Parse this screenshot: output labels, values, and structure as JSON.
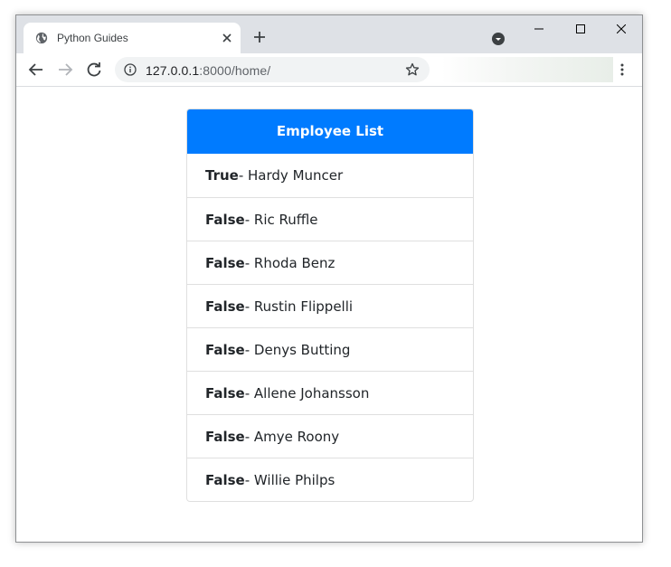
{
  "browser": {
    "tab_title": "Python Guides",
    "url_host": "127.0.0.1",
    "url_path": ":8000/home/"
  },
  "card": {
    "header": "Employee List",
    "items": [
      {
        "status": "True",
        "sep": "- ",
        "name": "Hardy Muncer"
      },
      {
        "status": "False",
        "sep": "- ",
        "name": "Ric Ruffle"
      },
      {
        "status": "False",
        "sep": "- ",
        "name": "Rhoda Benz"
      },
      {
        "status": "False",
        "sep": "- ",
        "name": "Rustin Flippelli"
      },
      {
        "status": "False",
        "sep": "- ",
        "name": "Denys Butting"
      },
      {
        "status": "False",
        "sep": "- ",
        "name": "Allene Johansson"
      },
      {
        "status": "False",
        "sep": "- ",
        "name": "Amye Roony"
      },
      {
        "status": "False",
        "sep": "- ",
        "name": "Willie Philps"
      }
    ]
  },
  "colors": {
    "header_bg": "#007bff",
    "titlebar_bg": "#dee1e6",
    "omnibox_bg": "#f1f3f4"
  }
}
